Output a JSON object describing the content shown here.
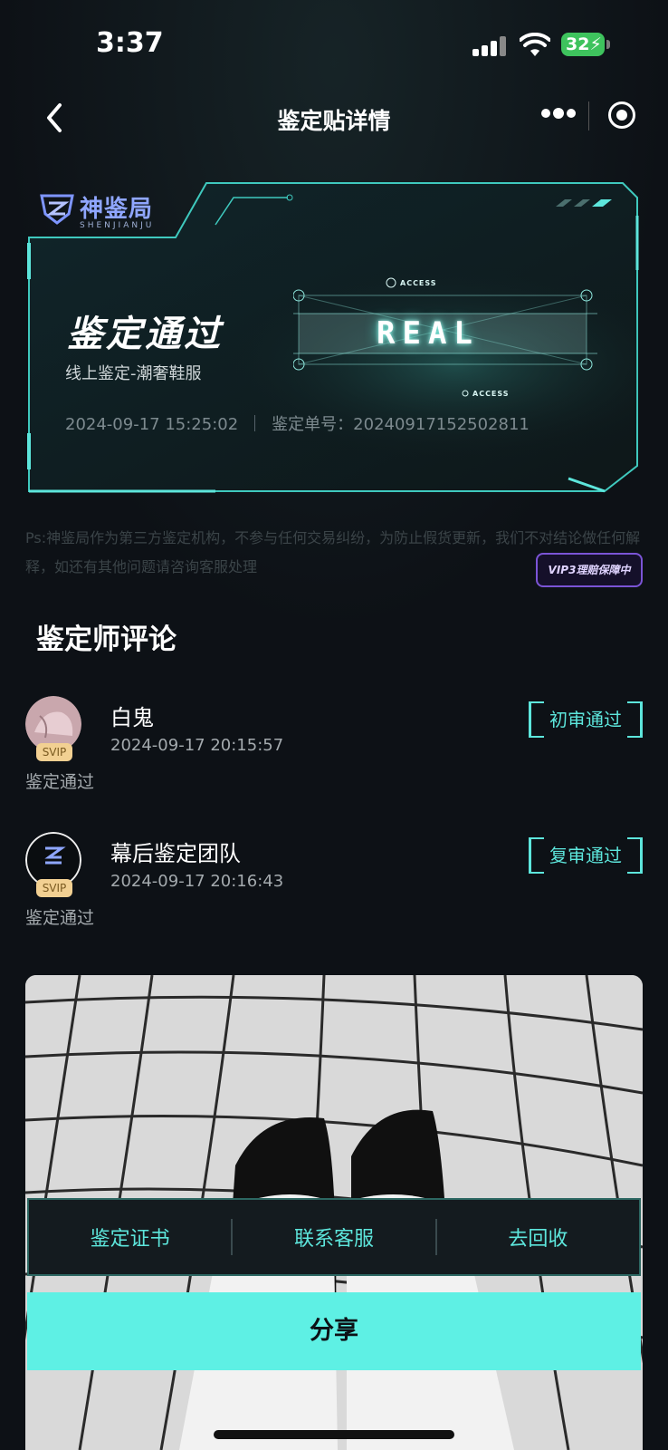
{
  "status_bar": {
    "time": "3:37",
    "battery": "32"
  },
  "nav": {
    "title": "鉴定贴详情"
  },
  "card": {
    "logo_text": "神鉴局",
    "logo_sub": "SHENJIANJU",
    "title": "鉴定通过",
    "subtitle": "线上鉴定-潮奢鞋服",
    "datetime": "2024-09-17 15:25:02",
    "order_label": "鉴定单号：",
    "order_no": "20240917152502811",
    "stamp_text": "REAL",
    "access_top": "ACCESS",
    "access_bottom": "ACCESS"
  },
  "disclaimer": "Ps:神鉴局作为第三方鉴定机构，不参与任何交易纠纷，为防止假货更新，我们不对结论做任何解释，如还有其他问题请咨询客服处理",
  "vip_badge": "VIP3理赔保障中",
  "comments_section": {
    "title": "鉴定师评论",
    "items": [
      {
        "name": "白鬼",
        "time": "2024-09-17 20:15:57",
        "text": "鉴定通过",
        "badge": "初审通过",
        "svip": "SVIP"
      },
      {
        "name": "幕后鉴定团队",
        "time": "2024-09-17 20:16:43",
        "text": "鉴定通过",
        "badge": "复审通过",
        "svip": "SVIP"
      }
    ]
  },
  "actions": {
    "certificate": "鉴定证书",
    "contact": "联系客服",
    "recycle": "去回收",
    "share": "分享"
  },
  "colors": {
    "accent": "#5de6dc",
    "background": "#0d1116",
    "share_bg": "#5ef0e4",
    "vip": "#7b54d6"
  }
}
